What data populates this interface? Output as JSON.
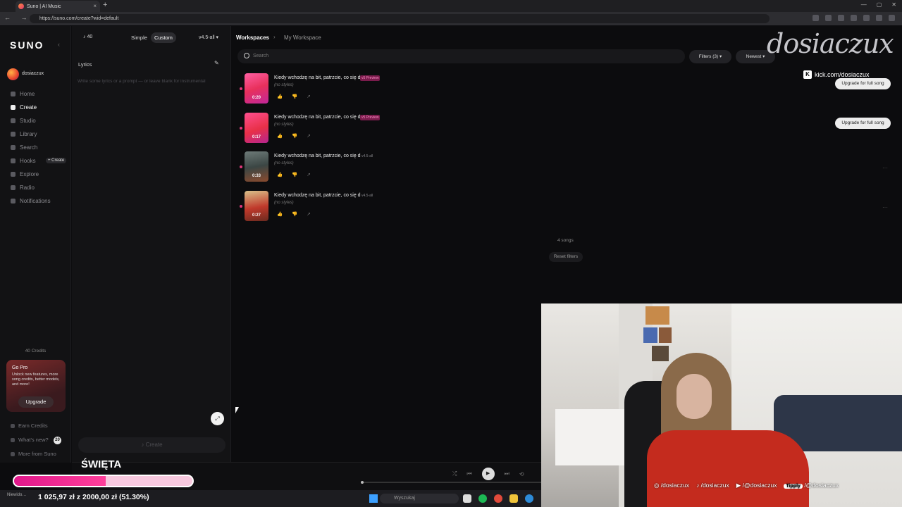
{
  "browser": {
    "tab_title": "Suno | AI Music",
    "url": "https://suno.com/create?wid=default",
    "new_tab": "+",
    "tab_close": "×",
    "nav_buttons": "← → ⟳",
    "window_controls": [
      "—",
      "▢",
      "✕"
    ]
  },
  "sidebar": {
    "logo": "SUNO",
    "collapse": "‹",
    "user": "dosiaczux",
    "nav": [
      {
        "label": "Home",
        "icon": "home-icon"
      },
      {
        "label": "Create",
        "icon": "create-icon",
        "active": true
      },
      {
        "label": "Studio",
        "icon": "studio-icon"
      },
      {
        "label": "Library",
        "icon": "library-icon"
      },
      {
        "label": "Search",
        "icon": "search-icon"
      },
      {
        "label": "Hooks",
        "icon": "hooks-icon"
      },
      {
        "label": "Explore",
        "icon": "explore-icon"
      },
      {
        "label": "Radio",
        "icon": "radio-icon"
      },
      {
        "label": "Notifications",
        "icon": "bell-icon"
      }
    ],
    "hooks_create": "+ Create",
    "credits": "40 Credits",
    "gopro": {
      "title": "Go Pro",
      "desc": "Unlock new features, more song credits, better models, and more!",
      "button": "Upgrade"
    },
    "footer": [
      "Earn Credits",
      "What's new?",
      "More from Suno"
    ],
    "whats_new_badge": "20"
  },
  "create_panel": {
    "credit_count": "♪ 40",
    "mode_simple": "Simple",
    "mode_custom": "Custom",
    "version": "v4.5-all ▾",
    "lyrics_label": "Lyrics",
    "lyrics_placeholder": "Write some lyrics or a prompt — or leave blank for instrumental",
    "create_button": "♪ Create"
  },
  "main": {
    "crumb_workspaces": "Workspaces",
    "crumb_sep": "›",
    "crumb_current": "My Workspace",
    "search_placeholder": "Search",
    "filters": "Filters (3) ▾",
    "sort": "Newest ▾",
    "songs": [
      {
        "title": "Kiedy wchodzę na bit, patrzcie, co się d",
        "tag": "v5 Preview",
        "style": "(no styles)",
        "duration": "0:20",
        "upgrade": "Upgrade for full song"
      },
      {
        "title": "Kiedy wchodzę na bit, patrzcie, co się d",
        "tag": "v5 Preview",
        "style": "(no styles)",
        "duration": "0:17",
        "upgrade": "Upgrade for full song"
      },
      {
        "title": "Kiedy wchodzę na bit, patrzcie, co się d",
        "tag": "v4.5-all",
        "style": "(no styles)",
        "duration": "0:33",
        "more": "···"
      },
      {
        "title": "Kiedy wchodzę na bit, patrzcie, co się d",
        "tag": "v4.5-all",
        "style": "(no styles)",
        "duration": "0:27",
        "more": "···"
      }
    ],
    "song_count": "4 songs",
    "reset_filters": "Reset filters"
  },
  "player": {
    "shuffle": "⤮",
    "prev": "⏮",
    "play": "▶",
    "next": "⏭",
    "repeat": "⟲",
    "progress": 0
  },
  "overlay": {
    "brand": "dosiaczux",
    "kick": "kick.com/dosiaczux",
    "goal_title": "ŚWIĘTA",
    "goal_text": "1 025,97 zł z 2000,00 zł (51.30%)",
    "goal_fraction": 0.513,
    "socials": {
      "instagram": "/dosiaczux",
      "tiktok": "/dosiaczux",
      "youtube": "/@dosiaczux",
      "tippy_label": "Tipply",
      "tippy": "/@dosiaczux"
    }
  },
  "taskbar": {
    "search_placeholder": "Wyszukaj",
    "weather": "Niewido…"
  },
  "colors": {
    "accent_pink": "#e0367a",
    "goal_fill": "#e0188a",
    "goal_bg": "#f7c8de"
  }
}
